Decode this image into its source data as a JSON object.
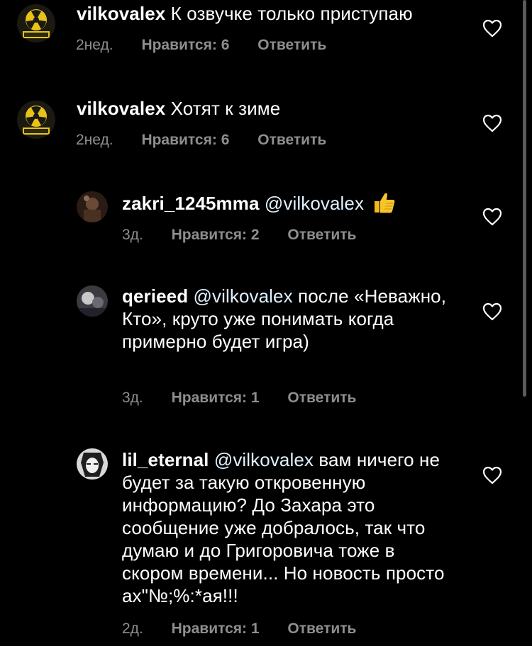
{
  "comments": [
    {
      "username": "vilkovalex",
      "mention": "",
      "text": "К озвучке только приступаю",
      "time": "2нед.",
      "likes": "Нравится: 6",
      "reply": "Ответить"
    },
    {
      "username": "vilkovalex",
      "mention": "",
      "text": "Хотят к зиме",
      "time": "2нед.",
      "likes": "Нравится: 6",
      "reply": "Ответить"
    },
    {
      "username": "zakri_1245mma",
      "mention": "@vilkovalex",
      "text": "",
      "time": "3д.",
      "likes": "Нравится: 2",
      "reply": "Ответить"
    },
    {
      "username": "qerieed",
      "mention": "@vilkovalex",
      "text": "после «Неважно, Кто», круто уже понимать когда примерно будет игра)",
      "time": "3д.",
      "likes": "Нравится: 1",
      "reply": "Ответить"
    },
    {
      "username": "lil_eternal",
      "mention": "@vilkovalex",
      "text": "вам ничего не будет за такую откровенную информацию? До Захара это сообщение уже добралось, так что думаю и до Григоровича тоже в скором времени... Но новость просто ах\"№;%:*ая!!!",
      "time": "2д.",
      "likes": "Нравится: 1",
      "reply": "Ответить"
    }
  ],
  "icons": {
    "like": "heart-outline-icon",
    "emoji": "thumbs-up-emoji"
  },
  "colors": {
    "background": "#000000",
    "text": "#ffffff",
    "muted": "#8e8e8e",
    "avatar_yellow": "#e8c21a"
  }
}
